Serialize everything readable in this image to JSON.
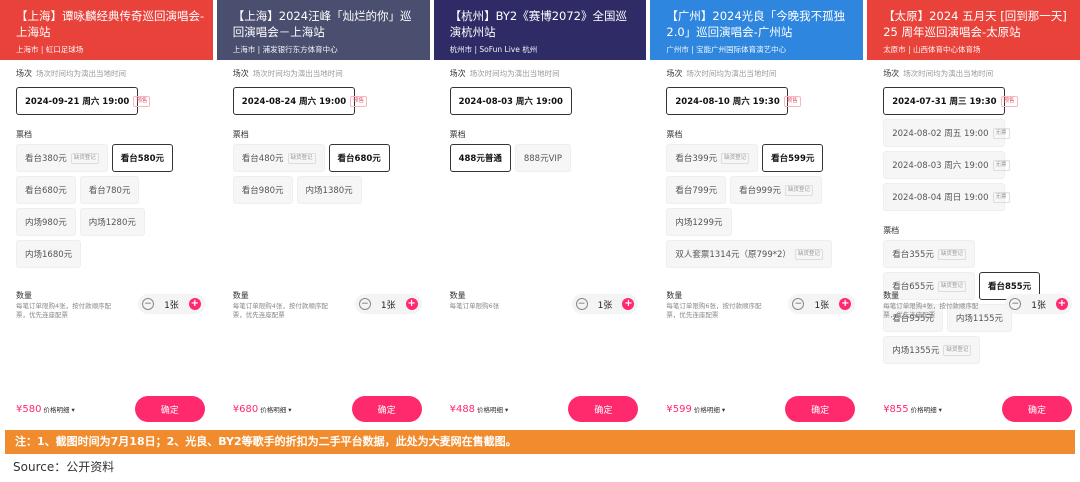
{
  "panels": [
    {
      "id": "shanghai-tan",
      "header_color": "#e8423b",
      "title": "【上海】谭咏麟经典传奇巡回演唱会-上海站",
      "venue": "上海市 | 虹口足球场",
      "session_label": "场次",
      "session_hint": "场次时间均为演出当地时间",
      "sessions": [
        {
          "label": "2024-09-21 周六 19:00",
          "tag": "预售",
          "selected": true
        }
      ],
      "ticket_label": "票档",
      "tickets": [
        {
          "label": "看台380元",
          "tag": "缺货登记",
          "selected": false
        },
        {
          "label": "看台580元",
          "tag": "",
          "selected": true
        },
        {
          "label": "看台680元",
          "tag": "",
          "selected": false
        },
        {
          "label": "看台780元",
          "tag": "",
          "selected": false
        },
        {
          "label": "内场980元",
          "tag": "",
          "selected": false
        },
        {
          "label": "内场1280元",
          "tag": "",
          "selected": false
        },
        {
          "label": "内场1680元",
          "tag": "",
          "selected": false
        }
      ],
      "qty_label": "数量",
      "qty_desc": "每笔订单限购4张，按付款顺序配票，优先连座配票",
      "qty": "1张",
      "price": "¥580",
      "price_detail": "价格明细",
      "confirm": "确定"
    },
    {
      "id": "shanghai-wang",
      "header_color": "#4a4f6f",
      "title": "【上海】2024汪峰「灿烂的你」巡回演唱会－上海站",
      "venue": "上海市 | 浦发银行东方体育中心",
      "session_label": "场次",
      "session_hint": "场次时间均为演出当地时间",
      "sessions": [
        {
          "label": "2024-08-24 周六 19:00",
          "tag": "预售",
          "selected": true
        }
      ],
      "ticket_label": "票档",
      "tickets": [
        {
          "label": "看台480元",
          "tag": "缺货登记",
          "selected": false
        },
        {
          "label": "看台680元",
          "tag": "",
          "selected": true
        },
        {
          "label": "看台980元",
          "tag": "",
          "selected": false
        },
        {
          "label": "内场1380元",
          "tag": "",
          "selected": false
        }
      ],
      "qty_label": "数量",
      "qty_desc": "每笔订单限购4张，按付款顺序配票，优先连座配票",
      "qty": "1张",
      "price": "¥680",
      "price_detail": "价格明细",
      "confirm": "确定"
    },
    {
      "id": "hangzhou-by2",
      "header_color": "#2f2b66",
      "title": "【杭州】BY2《赛博2072》全国巡演杭州站",
      "venue": "杭州市 | SoFun Live 杭州",
      "session_label": "场次",
      "session_hint": "场次时间均为演出当地时间",
      "sessions": [
        {
          "label": "2024-08-03 周六 19:00",
          "tag": "",
          "selected": true
        }
      ],
      "ticket_label": "票档",
      "tickets": [
        {
          "label": "488元普通",
          "tag": "",
          "selected": true
        },
        {
          "label": "888元VIP",
          "tag": "",
          "selected": false
        }
      ],
      "qty_label": "数量",
      "qty_desc": "每笔订单限购6张",
      "qty": "1张",
      "price": "¥488",
      "price_detail": "价格明细",
      "confirm": "确定"
    },
    {
      "id": "guangzhou-guangliang",
      "header_color": "#2e86de",
      "title": "【广州】2024光良「今晚我不孤独2.0」巡回演唱会-广州站",
      "venue": "广州市 | 宝能广州国际体育演艺中心",
      "session_label": "场次",
      "session_hint": "场次时间均为演出当地时间",
      "sessions": [
        {
          "label": "2024-08-10 周六 19:30",
          "tag": "预售",
          "selected": true
        }
      ],
      "ticket_label": "票档",
      "tickets": [
        {
          "label": "看台399元",
          "tag": "缺货登记",
          "selected": false
        },
        {
          "label": "看台599元",
          "tag": "",
          "selected": true
        },
        {
          "label": "看台799元",
          "tag": "",
          "selected": false
        },
        {
          "label": "看台999元",
          "tag": "缺货登记",
          "selected": false
        },
        {
          "label": "内场1299元",
          "tag": "",
          "selected": false
        },
        {
          "label": "双人套票1314元（原799*2）",
          "tag": "缺货登记",
          "selected": false
        }
      ],
      "qty_label": "数量",
      "qty_desc": "每笔订单限购6张，按付款顺序配票，优先连座配票",
      "qty": "1张",
      "price": "¥599",
      "price_detail": "价格明细",
      "confirm": "确定"
    },
    {
      "id": "taiyuan-mayday",
      "header_color": "#e8423b",
      "title": "【太原】2024 五月天 [回到那一天] 25 周年巡回演唱会-太原站",
      "venue": "太原市 | 山西体育中心体育场",
      "session_label": "场次",
      "session_hint": "场次时间均为演出当地时间",
      "sessions": [
        {
          "label": "2024-07-31 周三 19:30",
          "tag": "预售",
          "selected": true
        },
        {
          "label": "2024-08-02 周五 19:00",
          "tag": "无票",
          "selected": false
        },
        {
          "label": "2024-08-03 周六 19:00",
          "tag": "无票",
          "selected": false
        },
        {
          "label": "2024-08-04 周日 19:00",
          "tag": "无票",
          "selected": false
        }
      ],
      "ticket_label": "票档",
      "tickets": [
        {
          "label": "看台355元",
          "tag": "缺货登记",
          "selected": false
        },
        {
          "label": "看台655元",
          "tag": "缺货登记",
          "selected": false
        },
        {
          "label": "看台855元",
          "tag": "",
          "selected": true
        },
        {
          "label": "看台955元",
          "tag": "",
          "selected": false
        },
        {
          "label": "内场1155元",
          "tag": "",
          "selected": false
        },
        {
          "label": "内场1355元",
          "tag": "缺货登记",
          "selected": false
        }
      ],
      "qty_label": "数量",
      "qty_desc": "每笔订单限购4张，按付款顺序配票，优先连座配票",
      "qty": "1张",
      "price": "¥855",
      "price_detail": "价格明细",
      "confirm": "确定"
    }
  ],
  "note": "注：1、截图时间为7月18日；2、光良、BY2等歌手的折扣为二手平台数据，此处为大麦网在售截图。",
  "source": "Source：公开资料"
}
